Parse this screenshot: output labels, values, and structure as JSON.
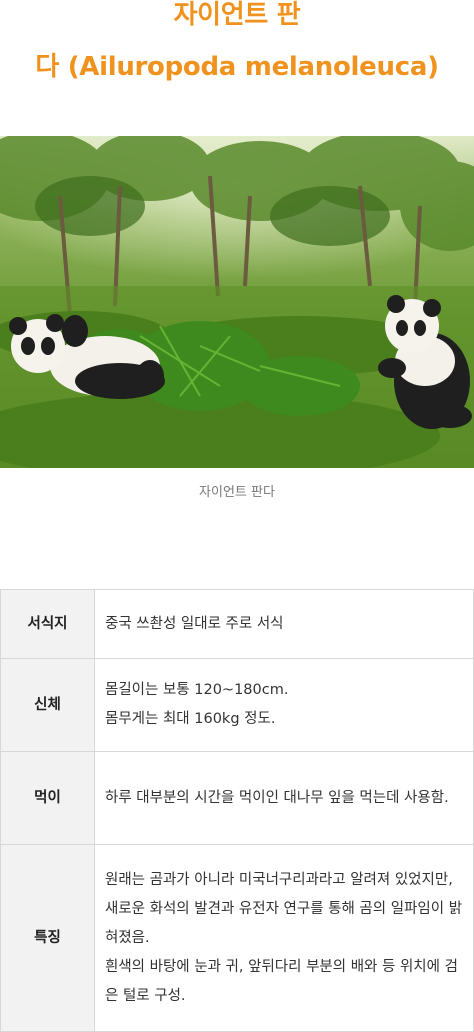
{
  "header": {
    "title_line1": "자이언트 판",
    "title_line2": "다 (Ailuropoda melanoleuca)"
  },
  "image": {
    "subject": "two giant pandas eating bamboo in a green forest clearing"
  },
  "caption": "자이언트 판다",
  "table": {
    "rows": [
      {
        "label": "서식지",
        "lines": [
          "중국 쓰촨성 일대로 주로 서식"
        ]
      },
      {
        "label": "신체",
        "lines": [
          "몸길이는 보통 120~180cm.",
          "몸무게는 최대 160kg 정도."
        ]
      },
      {
        "label": "먹이",
        "lines": [
          "하루 대부분의 시간을 먹이인 대나무 잎을 먹는데 사용함."
        ]
      },
      {
        "label": "특징",
        "lines": [
          "원래는 곰과가 아니라 미국너구리과라고 알려져 있었지만, 새로운 화석의 발견과 유전자 연구를 통해 곰의 일파임이 밝혀졌음.",
          "흰색의 바탕에 눈과 귀, 앞뒤다리 부분의 배와 등 위치에 검은 털로 구성."
        ]
      }
    ]
  },
  "colors": {
    "title": "#f0921e",
    "caption": "#777777",
    "label_bg": "#f2f2f2",
    "border": "#d7d7d7"
  }
}
